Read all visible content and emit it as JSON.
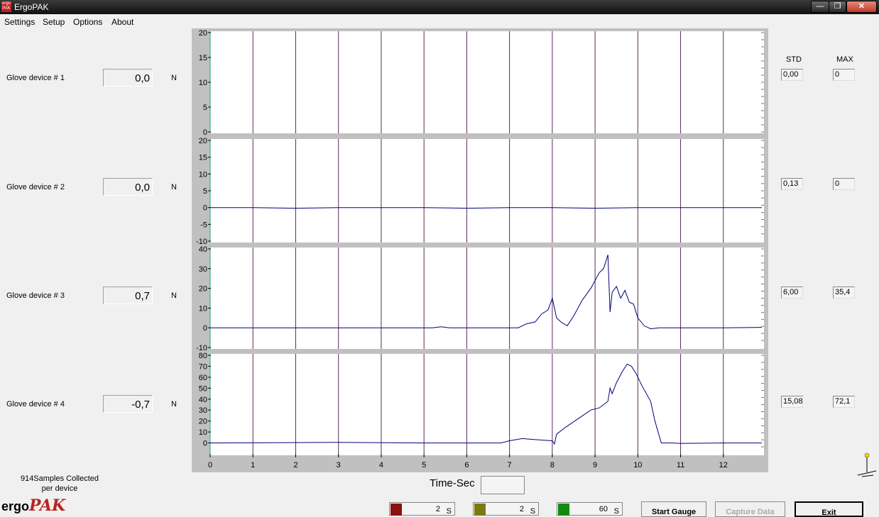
{
  "window": {
    "title": "ErgoPAK",
    "icon_text": "ergo PAK",
    "minimize": "—",
    "maximize": "❐",
    "close": "✕"
  },
  "menu": [
    "Settings",
    "Setup",
    "Options",
    "About"
  ],
  "devices": [
    {
      "label": "Glove device #  1",
      "value": "0,0",
      "unit": "N",
      "std": "0,00",
      "max": "0"
    },
    {
      "label": "Glove device #  2",
      "value": "0,0",
      "unit": "N",
      "std": "0,13",
      "max": "0"
    },
    {
      "label": "Glove device #  3",
      "value": "0,7",
      "unit": "N",
      "std": "6,00",
      "max": "35,4"
    },
    {
      "label": "Glove device #  4",
      "value": "-0,7",
      "unit": "N",
      "std": "15,08",
      "max": "72,1"
    }
  ],
  "stats_headers": {
    "std": "STD",
    "max": "MAX"
  },
  "chart_data": {
    "type": "line",
    "xlabel": "Time-Sec",
    "x_ticks": [
      "0",
      "1",
      "2",
      "3",
      "4",
      "5",
      "6",
      "7",
      "8",
      "9",
      "10",
      "11",
      "12"
    ],
    "xlim": [
      0,
      12.95
    ],
    "colors": {
      "line": "#00007a",
      "grid": "#5a2a5a",
      "band": "#c0c0c0"
    },
    "panels": [
      {
        "ylim": [
          0,
          20
        ],
        "ticks": [
          "0",
          "5",
          "10",
          "15",
          "20"
        ],
        "tick_values": [
          0,
          5,
          10,
          15,
          20
        ],
        "points": []
      },
      {
        "ylim": [
          -10,
          20
        ],
        "ticks": [
          "-10",
          "-5",
          "0",
          "5",
          "10",
          "15",
          "20"
        ],
        "tick_values": [
          -10,
          -5,
          0,
          5,
          10,
          15,
          20
        ],
        "points": [
          [
            0,
            0
          ],
          [
            1,
            0
          ],
          [
            2,
            -0.2
          ],
          [
            3,
            0
          ],
          [
            4,
            0
          ],
          [
            5,
            0
          ],
          [
            6,
            -0.2
          ],
          [
            7,
            0
          ],
          [
            8,
            0
          ],
          [
            9,
            -0.2
          ],
          [
            10,
            0
          ],
          [
            11,
            0
          ],
          [
            12,
            0
          ],
          [
            12.9,
            0
          ]
        ]
      },
      {
        "ylim": [
          -10,
          40
        ],
        "ticks": [
          "-10",
          "0",
          "10",
          "20",
          "30",
          "40"
        ],
        "tick_values": [
          -10,
          0,
          10,
          20,
          30,
          40
        ],
        "points": [
          [
            0,
            0
          ],
          [
            5.2,
            0
          ],
          [
            5.4,
            0.5
          ],
          [
            5.6,
            0
          ],
          [
            7.2,
            0
          ],
          [
            7.4,
            2
          ],
          [
            7.6,
            3
          ],
          [
            7.75,
            7
          ],
          [
            7.9,
            9
          ],
          [
            8.0,
            15
          ],
          [
            8.1,
            5
          ],
          [
            8.2,
            3
          ],
          [
            8.35,
            1
          ],
          [
            8.5,
            6
          ],
          [
            8.7,
            14
          ],
          [
            8.9,
            20
          ],
          [
            9.1,
            28
          ],
          [
            9.2,
            30
          ],
          [
            9.3,
            37
          ],
          [
            9.35,
            8
          ],
          [
            9.4,
            18
          ],
          [
            9.5,
            21
          ],
          [
            9.6,
            15
          ],
          [
            9.7,
            19
          ],
          [
            9.8,
            13
          ],
          [
            9.9,
            12
          ],
          [
            10.0,
            5
          ],
          [
            10.15,
            1
          ],
          [
            10.3,
            -0.5
          ],
          [
            10.5,
            0
          ],
          [
            11,
            0
          ],
          [
            12,
            0
          ],
          [
            12.9,
            0.2
          ]
        ]
      },
      {
        "ylim": [
          -10,
          80
        ],
        "ticks": [
          "0",
          "10",
          "20",
          "30",
          "40",
          "50",
          "60",
          "70",
          "80"
        ],
        "tick_values": [
          0,
          10,
          20,
          30,
          40,
          50,
          60,
          70,
          80
        ],
        "points": [
          [
            0,
            0
          ],
          [
            3,
            0.5
          ],
          [
            5,
            0
          ],
          [
            6.8,
            0
          ],
          [
            7,
            2
          ],
          [
            7.3,
            4
          ],
          [
            7.6,
            3
          ],
          [
            8.0,
            2
          ],
          [
            8.05,
            -1
          ],
          [
            8.1,
            8
          ],
          [
            8.3,
            14
          ],
          [
            8.6,
            22
          ],
          [
            8.9,
            30
          ],
          [
            9.1,
            32
          ],
          [
            9.3,
            38
          ],
          [
            9.35,
            50
          ],
          [
            9.4,
            45
          ],
          [
            9.5,
            55
          ],
          [
            9.65,
            66
          ],
          [
            9.75,
            72
          ],
          [
            9.85,
            70
          ],
          [
            9.95,
            64
          ],
          [
            10.1,
            52
          ],
          [
            10.3,
            38
          ],
          [
            10.4,
            20
          ],
          [
            10.55,
            0
          ],
          [
            10.8,
            0
          ],
          [
            11,
            -0.5
          ],
          [
            12,
            0
          ],
          [
            12.9,
            0
          ]
        ]
      }
    ]
  },
  "status": {
    "samples": "914Samples Collected",
    "per_device": "per device"
  },
  "logo": {
    "prefix": "ergo",
    "suffix": "PAK"
  },
  "gauges": [
    {
      "color": "#8b1010",
      "value": "2",
      "unit": "S"
    },
    {
      "color": "#7a7a10",
      "value": "2",
      "unit": "S"
    },
    {
      "color": "#108b10",
      "value": "60",
      "unit": "S"
    }
  ],
  "buttons": {
    "start": "Start Gauge",
    "capture": "Capture Data",
    "exit": "Exit"
  }
}
